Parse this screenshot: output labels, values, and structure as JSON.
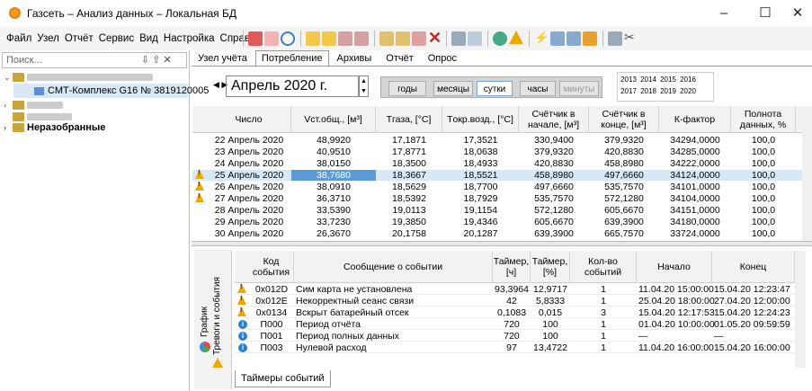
{
  "window": {
    "title": "Газсеть – Анализ данных – Локальная БД",
    "min": "–",
    "max": "☐",
    "close": "✕"
  },
  "menu": [
    "Файл",
    "Узел",
    "Отчёт",
    "Сервис",
    "Вид",
    "Настройка",
    "Справка"
  ],
  "left": {
    "search_placeholder": "Поиск...",
    "search_icons": "⇩ ⇧ ✕",
    "selected_node": "СМТ-Комплекс G16 № 3819120005",
    "unsorted": "Неразобранные"
  },
  "tabs": [
    "Узел учёта",
    "Потребление",
    "Архивы",
    "Отчёт",
    "Опрос"
  ],
  "date": {
    "month": "Апрель",
    "year": "2020 г."
  },
  "granularity": [
    "годы",
    "месяцы",
    "сутки",
    "часы",
    "минуты"
  ],
  "years": [
    "2013",
    "2014",
    "2015",
    "2016",
    "2017",
    "2018",
    "2019",
    "2020"
  ],
  "grid": {
    "headers": [
      "Число",
      "Vст.общ., [м³]",
      "Tгаза, [°C]",
      "Tокр.возд., [°C]",
      "Счётчик в начале, [м³]",
      "Счётчик в конце, [м³]",
      "К-фактор",
      "Полнота данных, %"
    ],
    "rows": [
      [
        "22 Апрель 2020",
        "48,9920",
        "17,1871",
        "17,3521",
        "330,9400",
        "379,9320",
        "34294,0000",
        "100,0"
      ],
      [
        "23 Апрель 2020",
        "40,9510",
        "17,8771",
        "18,0638",
        "379,9320",
        "420,8830",
        "34285,0000",
        "100,0"
      ],
      [
        "24 Апрель 2020",
        "38,0150",
        "18,3500",
        "18,4933",
        "420,8830",
        "458,8980",
        "34222,0000",
        "100,0"
      ],
      [
        "25 Апрель 2020",
        "38,7680",
        "18,3667",
        "18,5521",
        "458,8980",
        "497,6660",
        "34124,0000",
        "100,0"
      ],
      [
        "26 Апрель 2020",
        "38,0910",
        "18,5629",
        "18,7700",
        "497,6660",
        "535,7570",
        "34101,0000",
        "100,0"
      ],
      [
        "27 Апрель 2020",
        "36,3710",
        "18,5392",
        "18,7929",
        "535,7570",
        "572,1280",
        "34104,0000",
        "100,0"
      ],
      [
        "28 Апрель 2020",
        "33,5390",
        "19,0113",
        "19,1154",
        "572,1280",
        "605,6670",
        "34151,0000",
        "100,0"
      ],
      [
        "29 Апрель 2020",
        "33,7230",
        "19,3850",
        "19,4346",
        "605,6670",
        "639,3900",
        "34180,0000",
        "100,0"
      ],
      [
        "30 Апрель 2020",
        "26,3670",
        "20,1758",
        "20,1287",
        "639,3900",
        "665,7570",
        "33724,0000",
        "100,0"
      ]
    ]
  },
  "side": {
    "chart": "График",
    "alarms": "Тревоги и события"
  },
  "events": {
    "headers": [
      "Код события",
      "Сообщение о событии",
      "Таймер, [ч]",
      "Таймер, [%]",
      "Кол-во событий",
      "Начало",
      "Конец"
    ],
    "rows": [
      [
        "0x012D",
        "Сим карта не установлена",
        "93,3964",
        "12,9717",
        "1",
        "11.04.20 15:00:00",
        "15.04.20 12:23:47"
      ],
      [
        "0x012E",
        "Некорректный сеанс связи",
        "42",
        "5,8333",
        "1",
        "25.04.20 18:00:00",
        "27.04.20 12:00:00"
      ],
      [
        "0x0134",
        "Вскрыт батарейный отсек",
        "0,1083",
        "0,015",
        "3",
        "15.04.20 12:17:53",
        "15.04.20 12:24:23"
      ],
      [
        "П000",
        "Период отчёта",
        "720",
        "100",
        "1",
        "01.04.20 10:00:00",
        "01.05.20 09:59:59"
      ],
      [
        "П001",
        "Период полных данных",
        "720",
        "100",
        "1",
        "—",
        "—"
      ],
      [
        "П003",
        "Нулевой расход",
        "97",
        "13,4722",
        "1",
        "11.04.20 16:00:00",
        "15.04.20 16:00:00"
      ]
    ]
  },
  "bottom_tab": "Таймеры событий"
}
